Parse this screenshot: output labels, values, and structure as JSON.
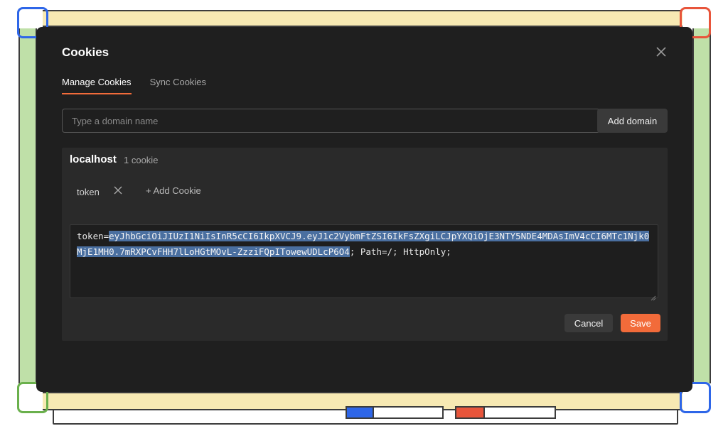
{
  "modal": {
    "title": "Cookies",
    "close_icon": "close-icon"
  },
  "tabs": [
    {
      "label": "Manage Cookies",
      "active": true
    },
    {
      "label": "Sync Cookies",
      "active": false
    }
  ],
  "domain": {
    "placeholder": "Type a domain name",
    "value": "",
    "add_label": "Add domain"
  },
  "cookie_group": {
    "host": "localhost",
    "count": "1 cookie",
    "cookies": [
      {
        "name": "token",
        "remove_icon": "close-icon"
      }
    ],
    "add_cookie_label": "+ Add Cookie"
  },
  "editor": {
    "prefix": "token=",
    "selected": "eyJhbGciOiJIUzI1NiIsInR5cCI6IkpXVCJ9.eyJ1c2VybmFtZSI6IkFsZXgiLCJpYXQiOjE3NTY5NDE4MDAsImV4cCI6MTc1Njk0MjE1MH0.7mRXPCvFHH7lLoHGtMOvL-ZzziFQpITowewUDLcP6O4",
    "suffix": "; Path=/; HttpOnly;"
  },
  "actions": {
    "cancel_label": "Cancel",
    "save_label": "Save"
  },
  "colors": {
    "accent": "#f26b3a",
    "modal_bg": "#1f1f1f",
    "panel_bg": "#2a2a2a",
    "selection": "#4a6fa0"
  }
}
